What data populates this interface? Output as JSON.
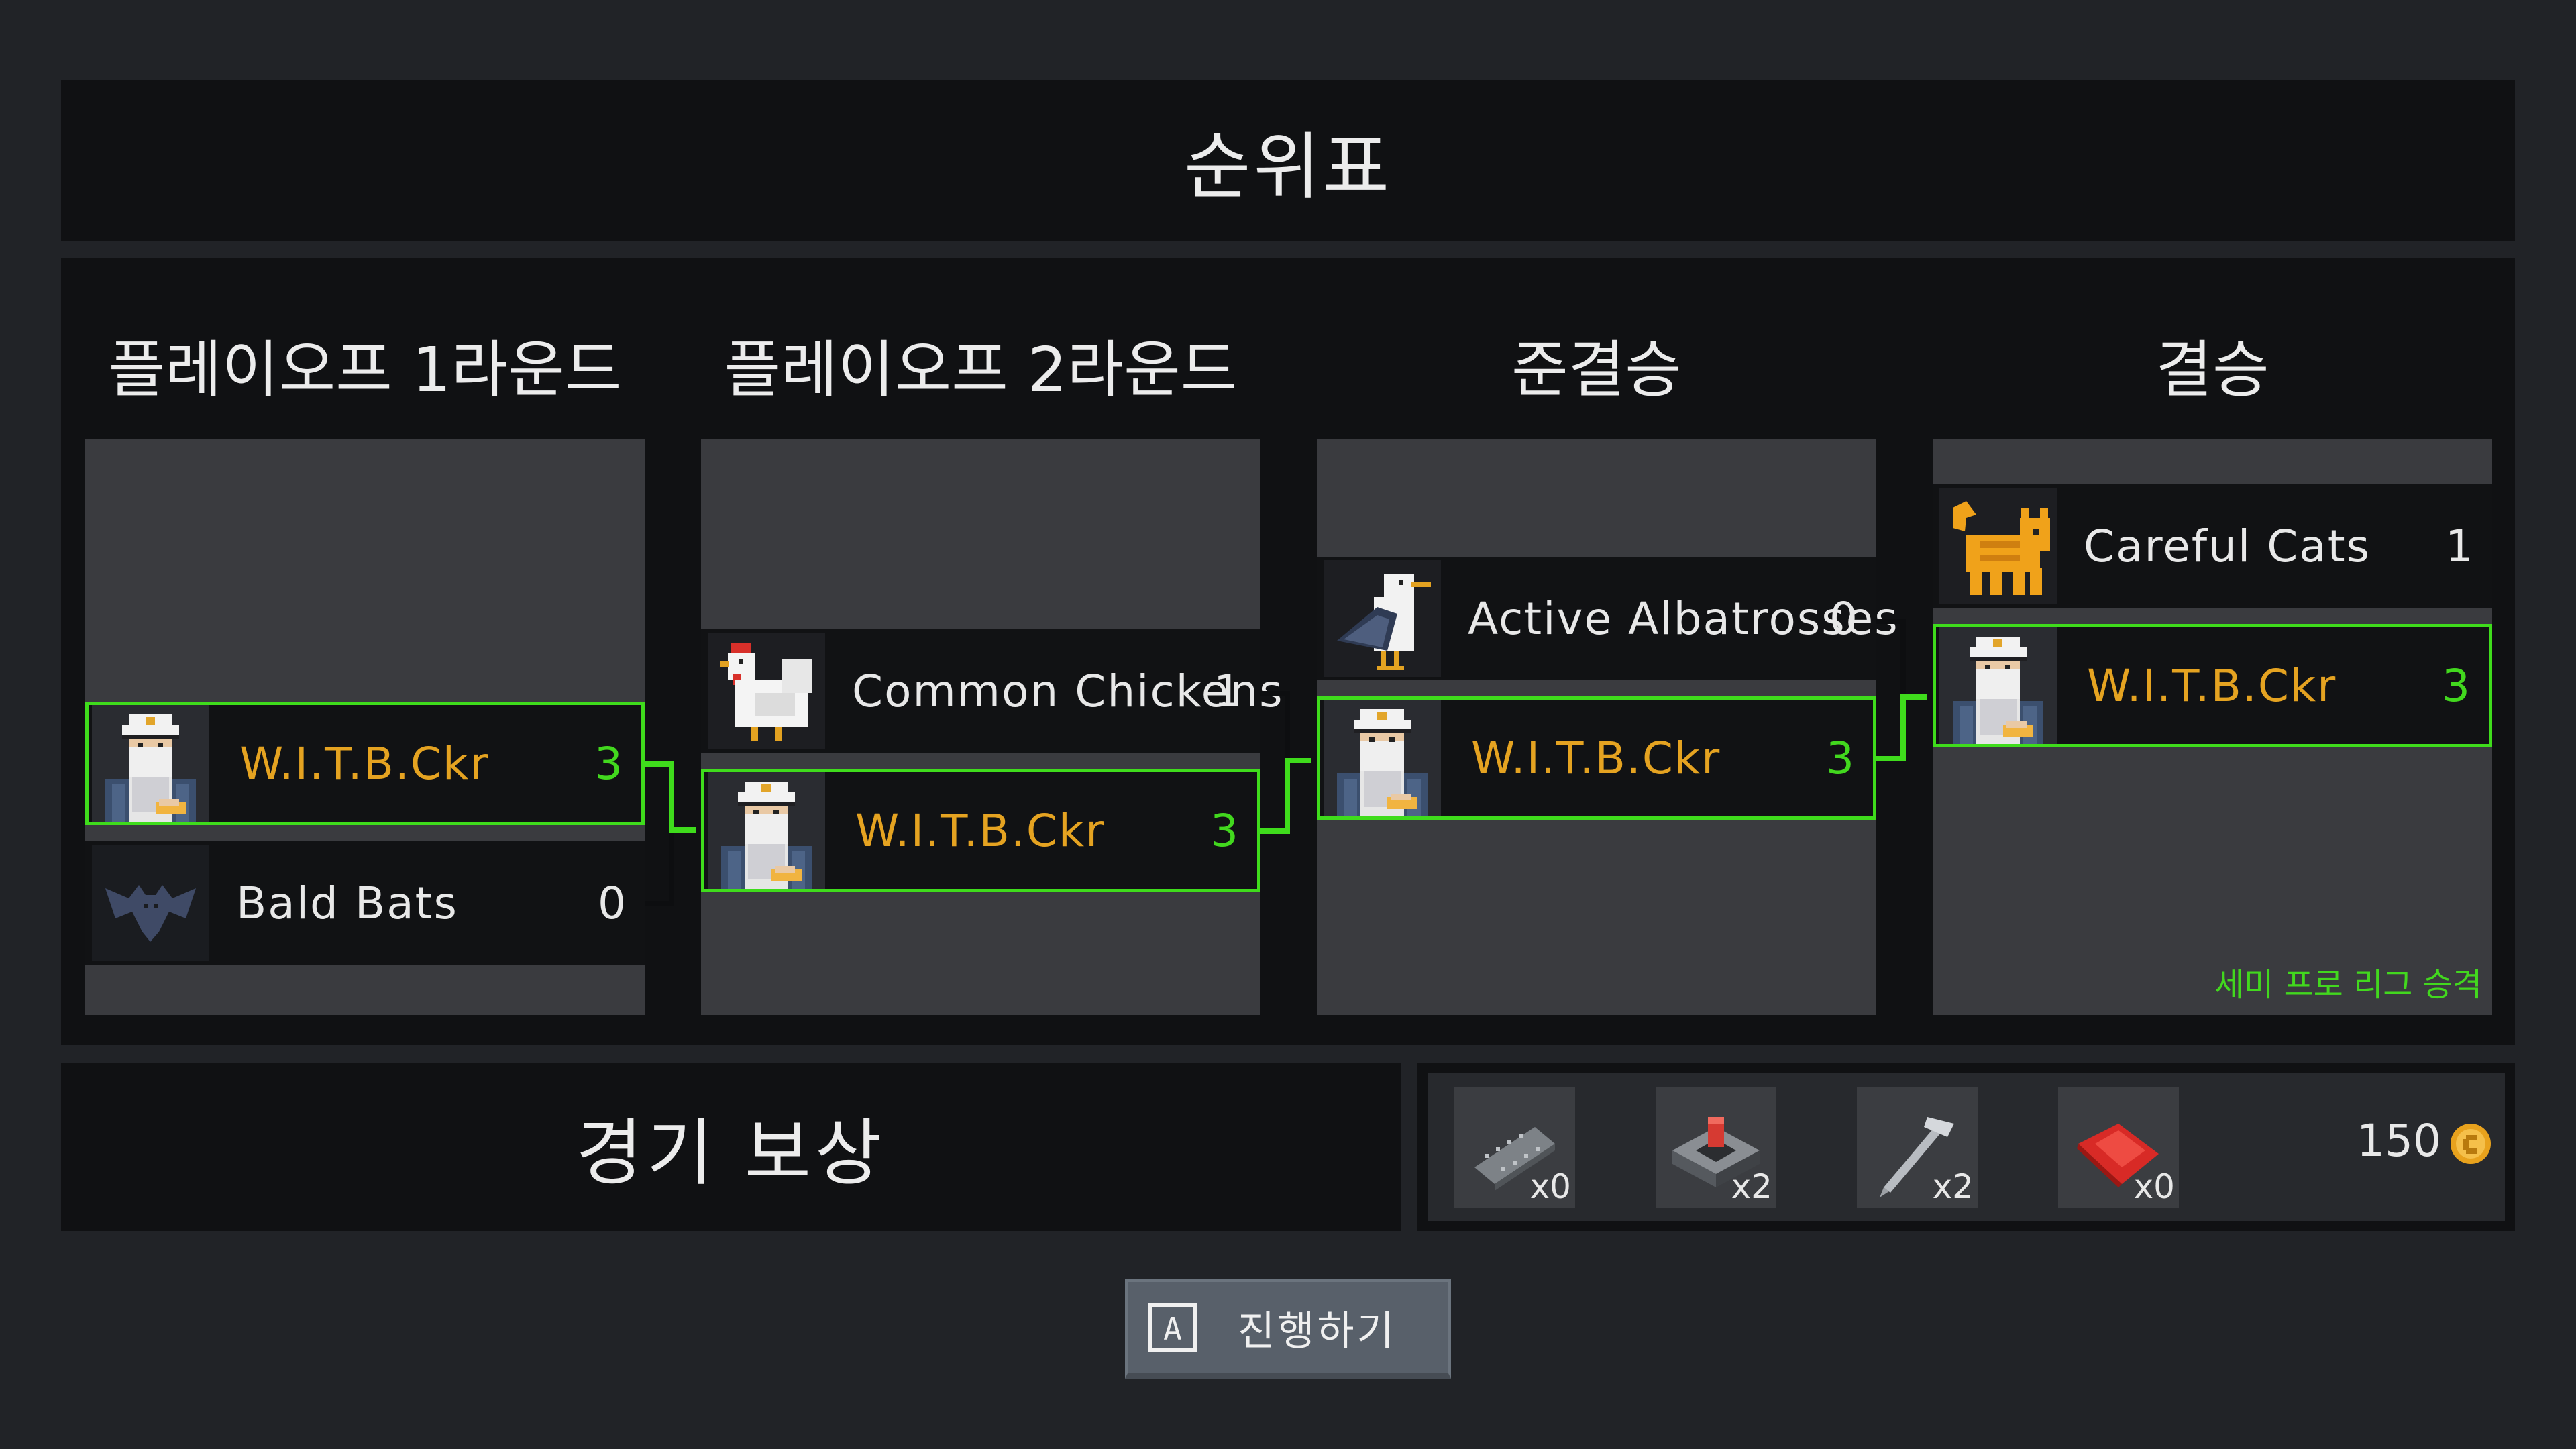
{
  "title": "순위표",
  "rounds": [
    {
      "label": "플레이오프 1라운드",
      "teams": [
        {
          "name": "W.I.T.B.Ckr",
          "score": "3",
          "icon": "captain-icon",
          "winner": true,
          "player": true
        },
        {
          "name": "Bald Bats",
          "score": "0",
          "icon": "bat-icon",
          "winner": false,
          "player": false
        }
      ]
    },
    {
      "label": "플레이오프 2라운드",
      "teams": [
        {
          "name": "Common Chickens",
          "score": "1",
          "icon": "chicken-icon",
          "winner": false,
          "player": false
        },
        {
          "name": "W.I.T.B.Ckr",
          "score": "3",
          "icon": "captain-icon",
          "winner": true,
          "player": true
        }
      ]
    },
    {
      "label": "준결승",
      "teams": [
        {
          "name": "Active Albatrosses",
          "score": "0",
          "icon": "albatross-icon",
          "winner": false,
          "player": false
        },
        {
          "name": "W.I.T.B.Ckr",
          "score": "3",
          "icon": "captain-icon",
          "winner": true,
          "player": true
        }
      ]
    },
    {
      "label": "결승",
      "teams": [
        {
          "name": "Careful Cats",
          "score": "1",
          "icon": "cat-icon",
          "winner": false,
          "player": false
        },
        {
          "name": "W.I.T.B.Ckr",
          "score": "3",
          "icon": "captain-icon",
          "winner": true,
          "player": true
        }
      ]
    }
  ],
  "promotion_text": "세미 프로 리그 승격",
  "rewards": {
    "label": "경기 보상",
    "items": [
      {
        "icon": "chip-icon",
        "count": "x0"
      },
      {
        "icon": "red-button-device-icon",
        "count": "x2"
      },
      {
        "icon": "nail-icon",
        "count": "x2"
      },
      {
        "icon": "red-cloth-icon",
        "count": "x0"
      }
    ],
    "currency": "150",
    "currency_icon": "coin-icon"
  },
  "proceed": {
    "key": "A",
    "label": "진행하기"
  },
  "colors": {
    "winner_border": "#3fdc1c",
    "player_name": "#e5a321",
    "winner_score": "#42d81e",
    "background": "#212327",
    "panel": "#101113",
    "column": "#3a3b3f"
  }
}
